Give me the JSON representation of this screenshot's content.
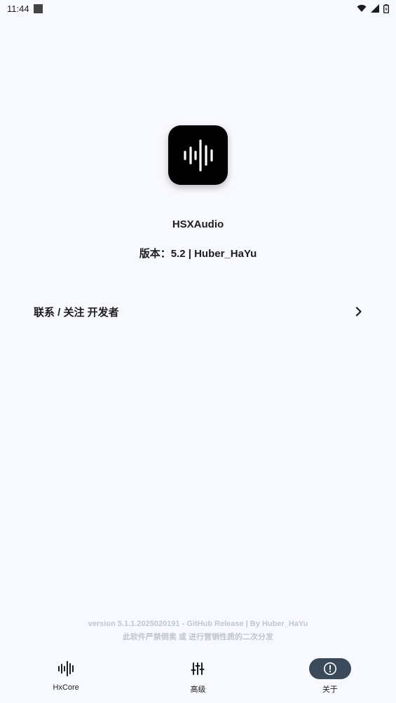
{
  "status_bar": {
    "time": "11:44",
    "icons": [
      "notification-square-icon",
      "wifi-icon",
      "signal-icon",
      "battery-icon"
    ]
  },
  "app": {
    "name": "HSXAudio",
    "version_line": "版本：5.2 | Huber_HaYu",
    "icon": "waveform-icon"
  },
  "contact": {
    "label": "联系 / 关注 开发者",
    "icon": "chevron-right-icon"
  },
  "footer": {
    "line1": "version 5.1.1.2025020191 - GitHub Release | By Huber_HaYu",
    "line2": "此软件严禁倒卖 或 进行营销性质的二次分发"
  },
  "nav": {
    "items": [
      {
        "label": "HxCore",
        "icon": "waveform-icon",
        "active": false
      },
      {
        "label": "高级",
        "icon": "sliders-icon",
        "active": false
      },
      {
        "label": "关于",
        "icon": "info-icon",
        "active": true
      }
    ]
  },
  "colors": {
    "background": "#f8f9fe",
    "active_nav": "#3b4a5a",
    "footer_text": "#c3c5cc"
  }
}
